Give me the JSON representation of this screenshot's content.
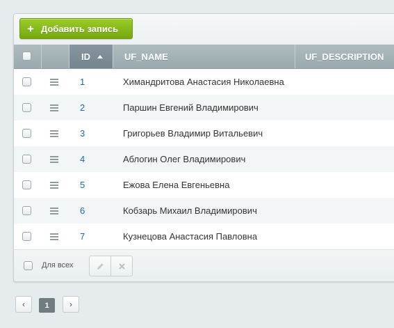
{
  "toolbar": {
    "add_icon": "+",
    "add_label": "Добавить запись"
  },
  "grid": {
    "columns": {
      "id": "ID",
      "uf_name": "UF_NAME",
      "uf_description": "UF_DESCRIPTION"
    },
    "sort_direction": "ascending",
    "rows": [
      {
        "id": "1",
        "name": "Химандритова Анастасия Николаевна"
      },
      {
        "id": "2",
        "name": "Паршин Евгений Владимирович"
      },
      {
        "id": "3",
        "name": "Григорьев Владимир Витальевич"
      },
      {
        "id": "4",
        "name": "Аблогин Олег Владимирович"
      },
      {
        "id": "5",
        "name": "Ежова Елена Евгеньевна"
      },
      {
        "id": "6",
        "name": "Кобзарь Михаил Владимирович"
      },
      {
        "id": "7",
        "name": "Кузнецова Анастасия Павловна"
      }
    ]
  },
  "footer": {
    "all_label": "Для всех",
    "edit_icon": "pencil-icon",
    "delete_icon": "close-icon"
  },
  "pager": {
    "prev": "‹",
    "current": "1",
    "next": "›"
  },
  "colors": {
    "accent": "#84b81b",
    "link": "#2067b0",
    "header": "#a3b2b6"
  }
}
